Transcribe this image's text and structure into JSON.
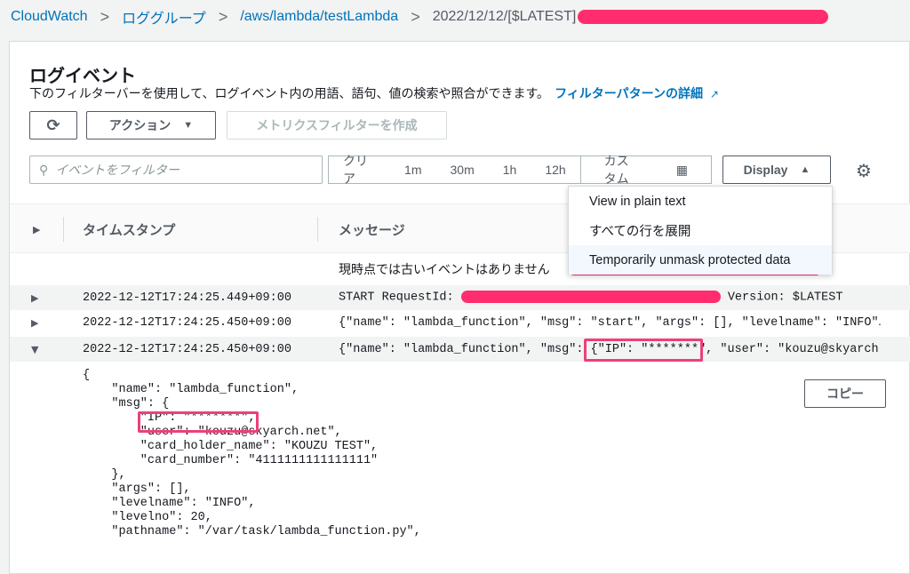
{
  "breadcrumb": {
    "items": [
      "CloudWatch",
      "ロググループ",
      "/aws/lambda/testLambda"
    ],
    "current": "2022/12/12/[$LATEST]"
  },
  "header": {
    "title": "ログイベント",
    "description": "下のフィルターバーを使用して、ログイベント内の用語、語句、値の検索や照合ができます。",
    "link": "フィルターパターンの詳細"
  },
  "toolbar": {
    "action_label": "アクション",
    "metric_filter_label": "メトリクスフィルターを作成",
    "search_placeholder": "イベントをフィルター",
    "clear": "クリア",
    "ranges": [
      "1m",
      "30m",
      "1h",
      "12h"
    ],
    "custom": "カスタム",
    "display_label": "Display"
  },
  "dropdown": {
    "items": [
      "View in plain text",
      "すべての行を展開",
      "Temporarily unmask protected data"
    ]
  },
  "table": {
    "col_timestamp": "タイムスタンプ",
    "col_message": "メッセージ",
    "no_older": "現時点では古いイベントはありません",
    "rows": [
      {
        "ts": "2022-12-12T17:24:25.449+09:00",
        "msg_a": "START RequestId: ",
        "msg_b": " Version: $LATEST"
      },
      {
        "ts": "2022-12-12T17:24:25.450+09:00",
        "msg": "{\"name\": \"lambda_function\", \"msg\": \"start\", \"args\": [], \"levelname\": \"INFO\"…"
      },
      {
        "ts": "2022-12-12T17:24:25.450+09:00",
        "msg": "{\"name\": \"lambda_function\", \"msg\": {\"IP\": \"*******\", \"user\": \"kouzu@skyarch.net\"…"
      }
    ]
  },
  "copy_label": "コピー",
  "json_lines": [
    "{",
    "    \"name\": \"lambda_function\",",
    "    \"msg\": {",
    "        \"IP\": \"*******\",",
    "        \"user\": \"kouzu@skyarch.net\",",
    "        \"card_holder_name\": \"KOUZU TEST\",",
    "        \"card_number\": \"4111111111111111\"",
    "    },",
    "    \"args\": [],",
    "    \"levelname\": \"INFO\",",
    "    \"levelno\": 20,",
    "    \"pathname\": \"/var/task/lambda_function.py\","
  ]
}
